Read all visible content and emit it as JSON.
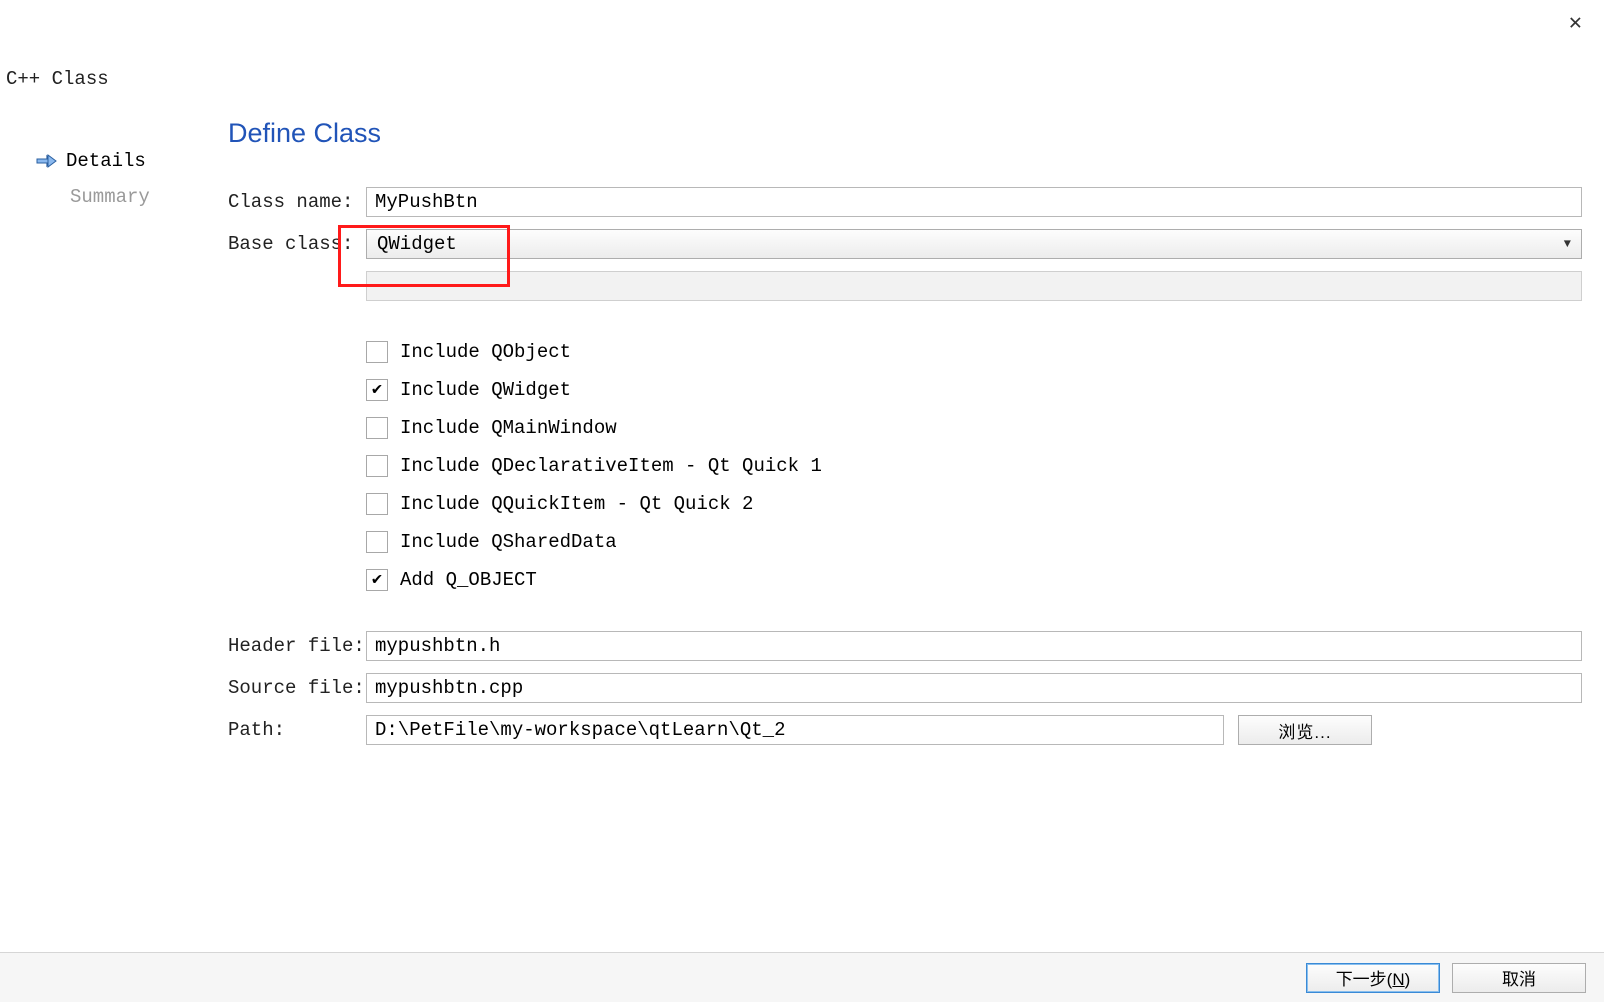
{
  "window": {
    "title": "C++ Class"
  },
  "sidebar": {
    "items": [
      {
        "label": "Details",
        "active": true
      },
      {
        "label": "Summary",
        "active": false
      }
    ]
  },
  "page": {
    "heading": "Define Class"
  },
  "form": {
    "class_name_label": "Class name:",
    "class_name_value": "MyPushBtn",
    "base_class_label": "Base class:",
    "base_class_value": "QWidget",
    "header_file_label": "Header file:",
    "header_file_value": "mypushbtn.h",
    "source_file_label": "Source file:",
    "source_file_value": "mypushbtn.cpp",
    "path_label": "Path:",
    "path_value": "D:\\PetFile\\my-workspace\\qtLearn\\Qt_2",
    "browse_label": "浏览..."
  },
  "checkboxes": [
    {
      "label": "Include QObject",
      "checked": false
    },
    {
      "label": "Include QWidget",
      "checked": true
    },
    {
      "label": "Include QMainWindow",
      "checked": false
    },
    {
      "label": "Include QDeclarativeItem - Qt Quick 1",
      "checked": false
    },
    {
      "label": "Include QQuickItem - Qt Quick 2",
      "checked": false
    },
    {
      "label": "Include QSharedData",
      "checked": false
    },
    {
      "label": "Add Q_OBJECT",
      "checked": true
    }
  ],
  "footer": {
    "next_label_prefix": "下一步(",
    "next_label_key": "N",
    "next_label_suffix": ")",
    "cancel_label": "取消"
  }
}
